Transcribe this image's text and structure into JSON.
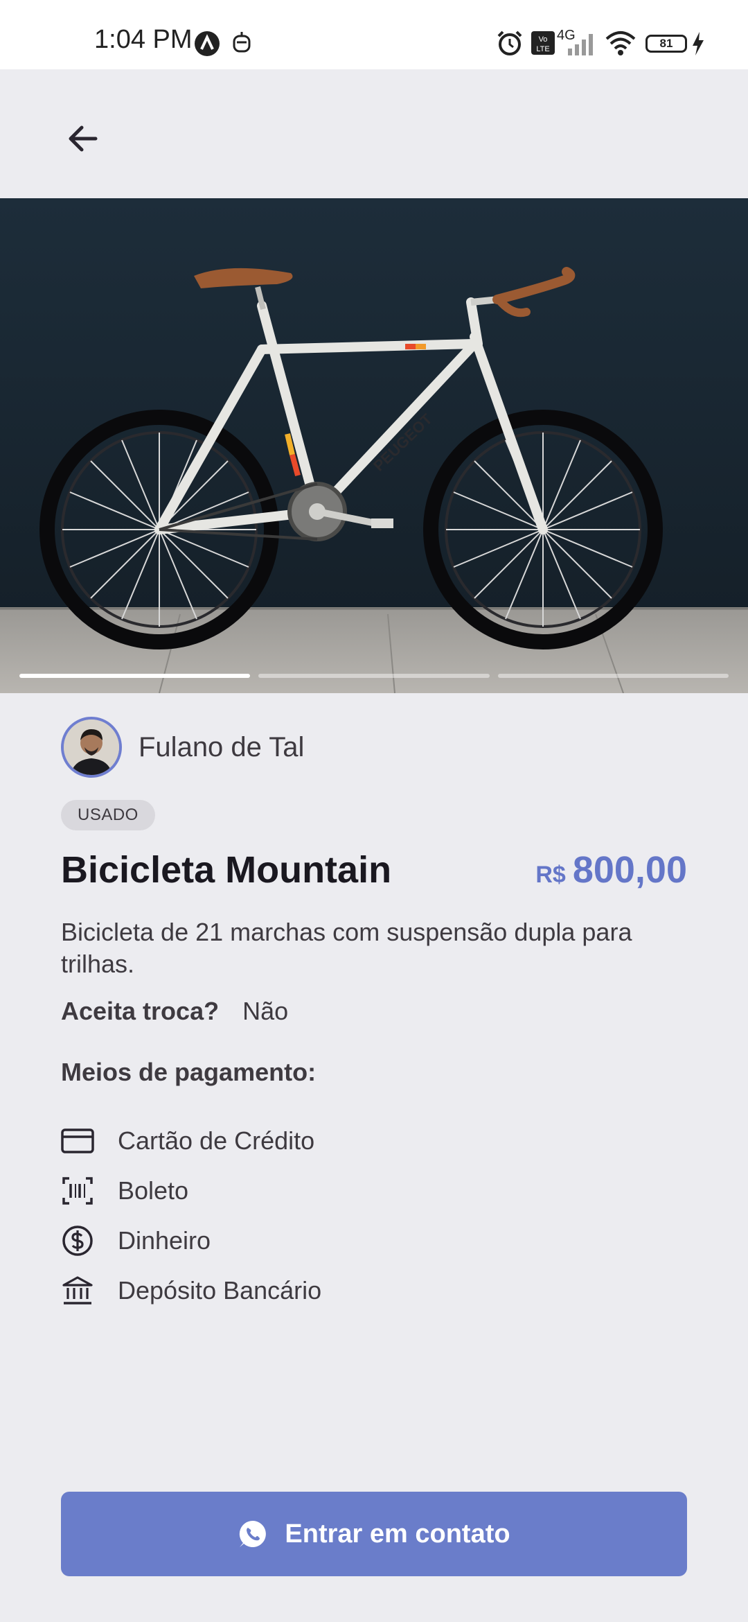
{
  "status_bar": {
    "time": "1:04 PM",
    "network": "4G",
    "battery": "81"
  },
  "header": {
    "back_icon": "arrow-left-icon"
  },
  "carousel": {
    "image_label": "PEUGEOT",
    "indicator_count": 3,
    "active_index": 0
  },
  "seller": {
    "name": "Fulano de Tal"
  },
  "product": {
    "condition": "USADO",
    "title": "Bicicleta Mountain",
    "price_currency": "R$",
    "price_value": "800,00",
    "description": "Bicicleta de 21 marchas com suspensão dupla para trilhas.",
    "trade_label": "Aceita troca?",
    "trade_value": "Não"
  },
  "payment": {
    "title": "Meios de pagamento:",
    "methods": [
      {
        "label": "Cartão de Crédito",
        "icon": "credit-card-icon"
      },
      {
        "label": "Boleto",
        "icon": "barcode-icon"
      },
      {
        "label": "Dinheiro",
        "icon": "money-icon"
      },
      {
        "label": "Depósito Bancário",
        "icon": "bank-icon"
      }
    ]
  },
  "actions": {
    "contact_label": "Entrar em contato",
    "contact_icon": "whatsapp-icon"
  },
  "colors": {
    "accent": "#6a7dca",
    "price": "#6476c8",
    "background": "#ececf0"
  }
}
